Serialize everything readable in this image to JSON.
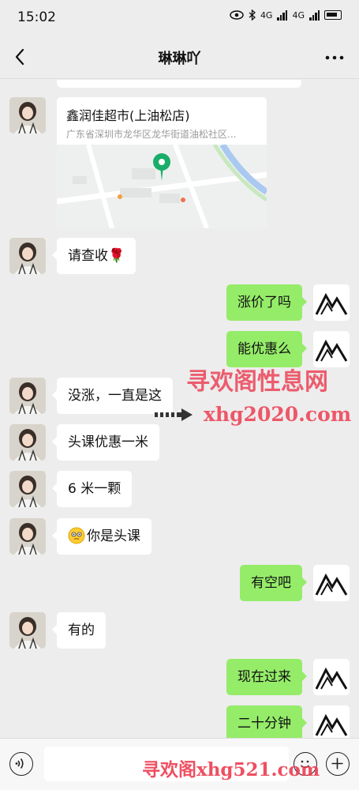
{
  "status_bar": {
    "time": "15:02",
    "net1": "4G",
    "net2": "4G"
  },
  "header": {
    "title": "琳琳吖"
  },
  "location": {
    "name": "鑫润佳超市(上油松店)",
    "address": "广东省深圳市龙华区龙华街道油松社区..."
  },
  "messages": [
    {
      "side": "left",
      "text": "请查收🌹"
    },
    {
      "side": "right",
      "text": "涨价了吗"
    },
    {
      "side": "right",
      "text": "能优惠么"
    },
    {
      "side": "left",
      "text": "没涨，一直是这"
    },
    {
      "side": "left",
      "text": "头课优惠一米"
    },
    {
      "side": "left",
      "text": "6 米一颗"
    },
    {
      "side": "left",
      "text": "你是头课",
      "emoji": "face-icon"
    },
    {
      "side": "right",
      "text": "有空吧"
    },
    {
      "side": "left",
      "text": "有的"
    },
    {
      "side": "right",
      "text": "现在过来"
    },
    {
      "side": "right",
      "text": "二十分钟"
    }
  ],
  "watermarks": {
    "line1": "寻欢阁性息网",
    "line2": "xhg2020.com",
    "line3": "寻欢阁xhg521.com"
  },
  "colors": {
    "sent_bubble": "#95ec69",
    "received_bubble": "#ffffff",
    "background": "#ededed",
    "map_pin": "#1aad6a"
  }
}
